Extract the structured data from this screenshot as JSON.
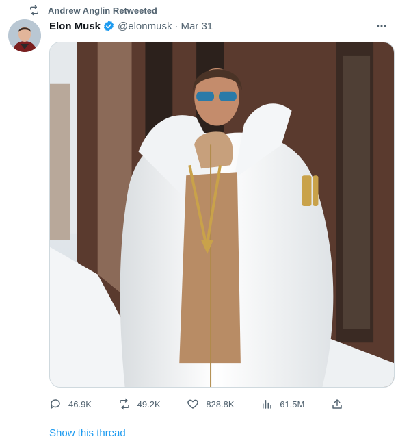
{
  "retweet": {
    "label": "Andrew Anglin Retweeted",
    "icon": "retweet-icon"
  },
  "author": {
    "name": "Elon Musk",
    "handle": "@elonmusk",
    "separator": "·",
    "date": "Mar 31",
    "verified_icon": "verified-badge-icon"
  },
  "media": {
    "description_icon": "photo-man-white-puffer-jacket"
  },
  "actions": {
    "replies": "46.9K",
    "retweets": "49.2K",
    "likes": "828.8K",
    "views": "61.5M"
  },
  "footer": {
    "thread_link": "Show this thread"
  },
  "colors": {
    "accent": "#1d9bf0",
    "muted": "#536471",
    "text": "#0f1419"
  }
}
